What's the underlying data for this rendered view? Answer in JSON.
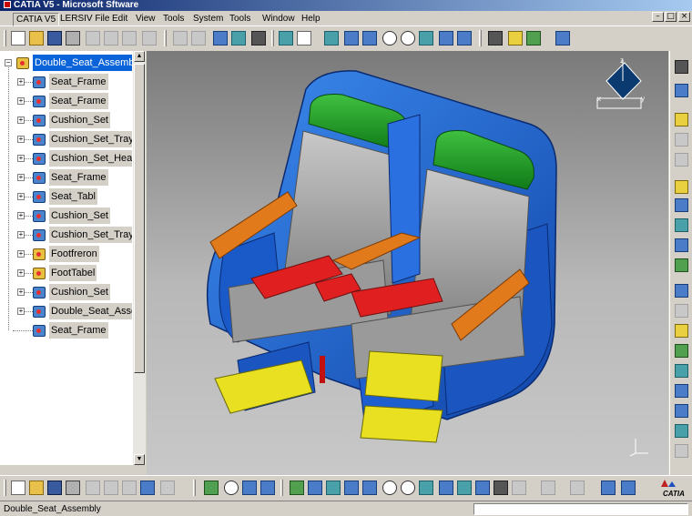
{
  "window": {
    "title": "CATIA V5 - Microsoft Sftware"
  },
  "menubar": {
    "items": [
      "CATIA V5",
      "LERSIV File",
      "Edit",
      "View",
      "Tools",
      "System",
      "Tools",
      "Window",
      "Help"
    ]
  },
  "window_buttons": {
    "minimize": "–",
    "restore": "□",
    "close": "×"
  },
  "tree": {
    "root": "Double_Seat_Assembly",
    "nodes": [
      "Seat_Frame",
      "Seat_Frame",
      "Cushion_Set",
      "Cushion_Set_Tray",
      "Cushion_Set_Head",
      "Seat_Frame",
      "Seat_Tabl",
      "Cushion_Set",
      "Cushion_Set_Tray",
      "Footfreron",
      "FootTabel",
      "Cushion_Set",
      "Double_Seat_Asse",
      "Seat_Frame"
    ]
  },
  "compass": {
    "x": "x",
    "y": "y",
    "z": "z"
  },
  "axis_marker": {
    "x": "x",
    "y": "y",
    "z": "z"
  },
  "logo": {
    "text": "CATIA"
  },
  "statusbar": {
    "text": "Double_Seat_Assembly",
    "command_value": ""
  },
  "colors": {
    "shell": "#1d63d6",
    "headrest": "#1f9e24",
    "armrest": "#e07a1a",
    "tray": "#e02020",
    "footrest": "#e8e020",
    "cushion": "#9a9a9a",
    "tree_selection": "#0a63d8"
  }
}
